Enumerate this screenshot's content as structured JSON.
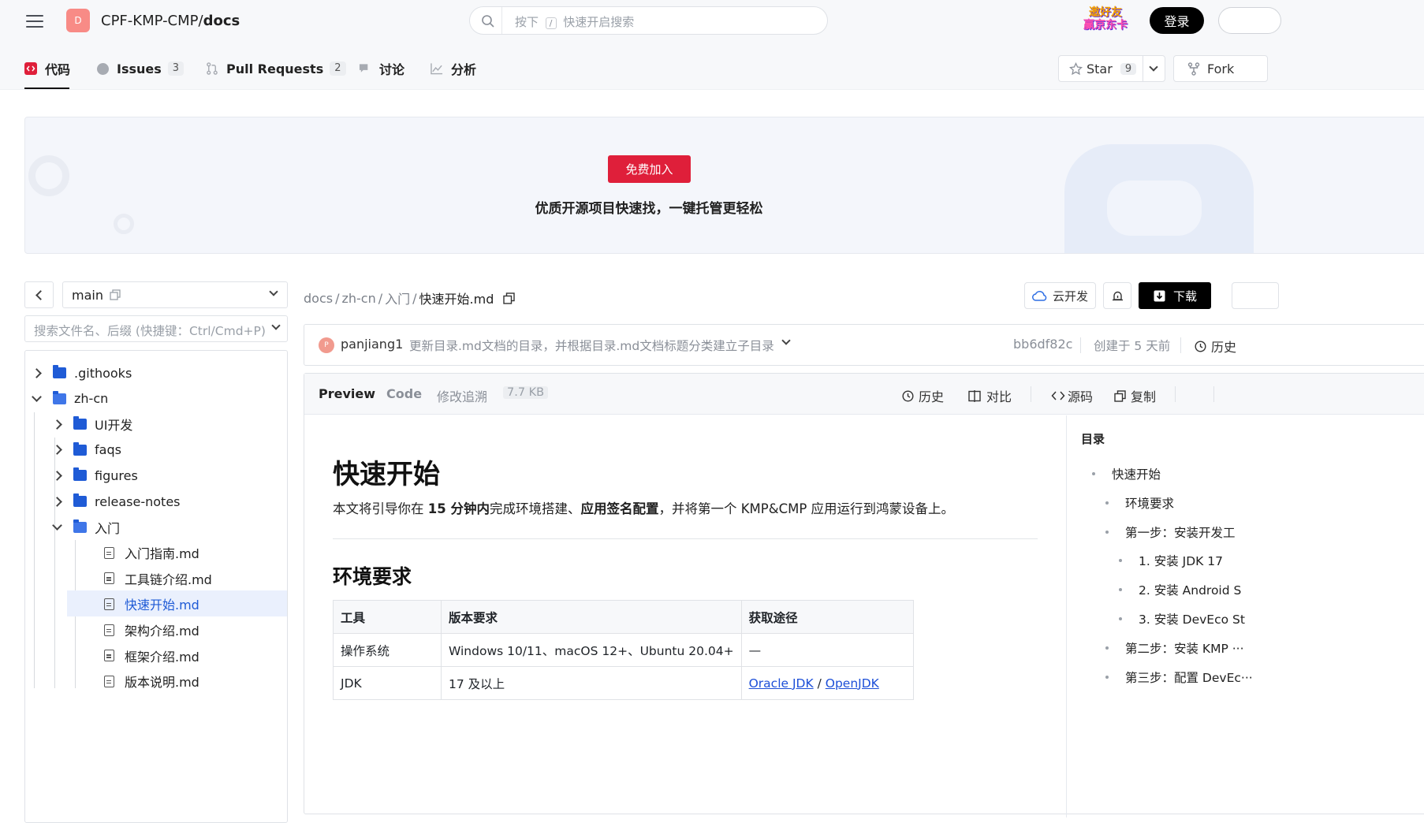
{
  "header": {
    "repo_avatar_letter": "D",
    "repo_owner": "CPF-KMP-CMP/",
    "repo_name": "docs",
    "search_placeholder_prefix": "按下",
    "search_shortcut": "/",
    "search_placeholder_suffix": "快速开启搜索",
    "promo_logo_line1": "邀好友",
    "promo_logo_line2": "赢京东卡",
    "login_label": "登录"
  },
  "tabs": [
    {
      "label": "代码",
      "count": ""
    },
    {
      "label": "Issues",
      "count": "3"
    },
    {
      "label": "Pull Requests",
      "count": "2"
    },
    {
      "label": "讨论",
      "count": ""
    },
    {
      "label": "分析",
      "count": ""
    }
  ],
  "repo_actions": {
    "star_label": "Star",
    "star_count": "9",
    "fork_label": "Fork"
  },
  "banner": {
    "join_label": "免费加入",
    "slogan": "优质开源项目快速找，一键托管更轻松"
  },
  "sidebar": {
    "branch": "main",
    "file_search_placeholder": "搜索文件名、后缀 (快捷键：Ctrl/Cmd+P)",
    "tree": [
      {
        "name": ".githooks",
        "type": "folder",
        "depth": 0,
        "expanded": false
      },
      {
        "name": "zh-cn",
        "type": "folder",
        "depth": 0,
        "expanded": true
      },
      {
        "name": "UI开发",
        "type": "folder",
        "depth": 1,
        "expanded": false
      },
      {
        "name": "faqs",
        "type": "folder",
        "depth": 1,
        "expanded": false
      },
      {
        "name": "figures",
        "type": "folder",
        "depth": 1,
        "expanded": false
      },
      {
        "name": "release-notes",
        "type": "folder",
        "depth": 1,
        "expanded": false
      },
      {
        "name": "入门",
        "type": "folder",
        "depth": 1,
        "expanded": true
      },
      {
        "name": "入门指南.md",
        "type": "file",
        "depth": 2
      },
      {
        "name": "工具链介绍.md",
        "type": "file",
        "depth": 2
      },
      {
        "name": "快速开始.md",
        "type": "file",
        "depth": 2,
        "selected": true
      },
      {
        "name": "架构介绍.md",
        "type": "file",
        "depth": 2
      },
      {
        "name": "框架介绍.md",
        "type": "file",
        "depth": 2
      },
      {
        "name": "版本说明.md",
        "type": "file",
        "depth": 2
      }
    ]
  },
  "breadcrumb": {
    "parts": [
      "docs",
      "zh-cn",
      "入门"
    ],
    "current": "快速开始.md"
  },
  "file_actions": {
    "cloud_dev_label": "云开发",
    "download_label": "下载"
  },
  "commit": {
    "author_initial": "P",
    "author": "panjiang1",
    "message": "更新目录.md文档的目录，并根据目录.md文档标题分类建立子目录",
    "hash": "bb6df82c",
    "created": "创建于 5 天前",
    "history_label": "历史"
  },
  "viewer": {
    "tabs": [
      "Preview",
      "Code",
      "修改追溯"
    ],
    "size": "7.7 KB",
    "tools": [
      "历史",
      "对比",
      "源码",
      "复制"
    ]
  },
  "doc": {
    "h1": "快速开始",
    "intro_before": "本文将引导你在 ",
    "intro_bold1": "15 分钟内",
    "intro_mid": "完成环境搭建、",
    "intro_bold2": "应用签名配置",
    "intro_after": "，并将第一个 KMP&CMP 应用运行到鸿蒙设备上。",
    "h2": "环境要求",
    "table_headers": [
      "工具",
      "版本要求",
      "获取途径"
    ],
    "rows": [
      {
        "tool": "操作系统",
        "version": "Windows 10/11、macOS 12+、Ubuntu 20.04+",
        "source": "—"
      },
      {
        "tool": "JDK",
        "version": "17 及以上",
        "link1": "Oracle JDK",
        "sep": "/",
        "link2": "OpenJDK"
      }
    ]
  },
  "toc": {
    "title": "目录",
    "items": [
      {
        "label": "快速开始",
        "level": 0
      },
      {
        "label": "环境要求",
        "level": 1
      },
      {
        "label": "第一步：安装开发工",
        "level": 1
      },
      {
        "label": "1. 安装 JDK 17",
        "level": 2
      },
      {
        "label": "2. 安装 Android S",
        "level": 2
      },
      {
        "label": "3. 安装 DevEco St",
        "level": 2
      },
      {
        "label": "第二步：安装 KMP ···",
        "level": 1
      },
      {
        "label": "第三步：配置 DevEc···",
        "level": 1
      }
    ]
  },
  "colors": {
    "accent_red": "#df1f3a",
    "link_blue": "#1d4fd8",
    "folder_blue": "#1f5bd6",
    "selected_bg": "#eaf0fd"
  }
}
